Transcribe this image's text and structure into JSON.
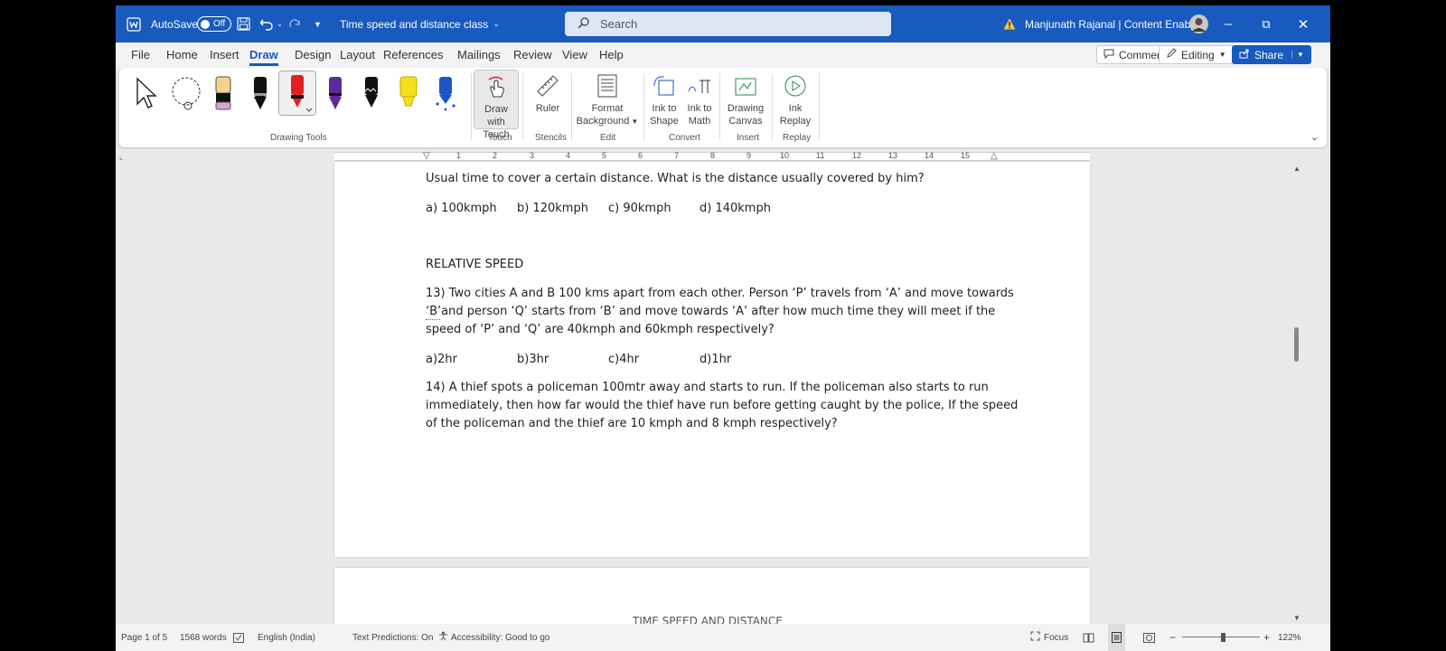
{
  "title_bar": {
    "autosave_label": "AutoSave",
    "autosave_state": "Off",
    "doc_title": "Time speed and distance class",
    "search_placeholder": "Search",
    "user": "Manjunath Rajanal | Content Enablers"
  },
  "menu": {
    "tabs": [
      "File",
      "Home",
      "Insert",
      "Draw",
      "Design",
      "Layout",
      "References",
      "Mailings",
      "Review",
      "View",
      "Help"
    ],
    "active": "Draw",
    "comments": "Comments",
    "editing": "Editing",
    "share": "Share"
  },
  "ribbon": {
    "draw_with_touch": [
      "Draw with",
      "Touch"
    ],
    "ruler": "Ruler",
    "format_background": [
      "Format",
      "Background"
    ],
    "ink_to_shape": [
      "Ink to",
      "Shape"
    ],
    "ink_to_math": [
      "Ink to",
      "Math"
    ],
    "drawing_canvas": [
      "Drawing",
      "Canvas"
    ],
    "ink_replay": [
      "Ink",
      "Replay"
    ],
    "groups": {
      "drawing_tools": "Drawing Tools",
      "touch": "Touch",
      "stencils": "Stencils",
      "edit": "Edit",
      "convert": "Convert",
      "insert": "Insert",
      "replay": "Replay"
    },
    "pen_colors": [
      "#f3d28a",
      "#111111",
      "#e02020",
      "#5b2aa0",
      "#111111",
      "#f5e11a",
      "#1a56c9"
    ]
  },
  "ruler_numbers": [
    "1",
    "2",
    "3",
    "4",
    "5",
    "6",
    "7",
    "8",
    "9",
    "10",
    "11",
    "12",
    "13",
    "14",
    "15"
  ],
  "document": {
    "line1": "Usual time to cover a certain distance. What is the distance usually covered by him?",
    "opts1": [
      "a) 100kmph",
      "b) 120kmph",
      "c) 90kmph",
      "d) 140kmph"
    ],
    "heading": "RELATIVE SPEED",
    "q13_lines": [
      "13) Two cities A and B 100 kms apart from each other. Person ‘P’ travels from ‘A’ and move towards",
      "‘B’and person ‘Q’ starts from ‘B’ and move towards ‘A’ after how much time they will meet if the",
      "speed of ‘P’ and ‘Q’ are 40kmph and 60kmph respectively?"
    ],
    "opts13": [
      "a)2hr",
      "b)3hr",
      "c)4hr",
      "d)1hr"
    ],
    "q14_lines": [
      "14) A thief spots a policeman 100mtr away and starts to run. If the policeman also starts to run",
      "immediately, then how far would the thief have run before getting caught by the police, If the speed",
      "of the policeman and the thief are 10 kmph and 8 kmph respectively?"
    ],
    "next_page_heading": "TIME SPEED AND DISTANCE"
  },
  "status": {
    "page": "Page 1 of 5",
    "words": "1568 words",
    "language": "English (India)",
    "predictions": "Text Predictions: On",
    "accessibility": "Accessibility: Good to go",
    "focus": "Focus",
    "zoom": "122%"
  }
}
